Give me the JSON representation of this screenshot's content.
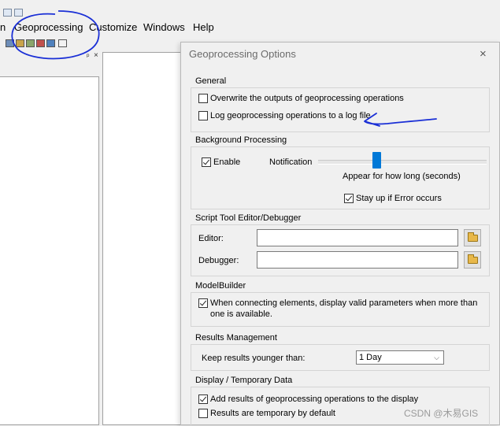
{
  "menubar": {
    "items": [
      "n",
      "Geoprocessing",
      "Customize",
      "Windows",
      "Help"
    ]
  },
  "panel": {
    "pin": "ᵖ",
    "close": "×"
  },
  "dialog": {
    "title": "Geoprocessing Options",
    "close_glyph": "×",
    "general": {
      "title": "General",
      "overwrite": {
        "label": "Overwrite the outputs of geoprocessing operations",
        "checked": false
      },
      "log": {
        "label": "Log geoprocessing operations to a log file",
        "checked": false
      }
    },
    "background": {
      "title": "Background Processing",
      "enable": {
        "label": "Enable",
        "checked": true
      },
      "notification_label": "Notification",
      "slider_caption": "Appear for how long (seconds)",
      "slider_level": 0.35,
      "stay_up": {
        "label": "Stay up if Error occurs",
        "checked": true
      }
    },
    "script_tool": {
      "title": "Script Tool Editor/Debugger",
      "editor_label": "Editor:",
      "editor_value": "",
      "debugger_label": "Debugger:",
      "debugger_value": ""
    },
    "modelbuilder": {
      "title": "ModelBuilder",
      "valid_params": {
        "label": "When connecting elements, display valid parameters when more than one is available.",
        "checked": true
      }
    },
    "results": {
      "title": "Results Management",
      "keep_label": "Keep results younger than:",
      "keep_value": "1 Day"
    },
    "display": {
      "title": "Display / Temporary Data",
      "add_results": {
        "label": "Add results of geoprocessing operations to the display",
        "checked": true
      },
      "temporary": {
        "label": "Results are temporary by default",
        "checked": false
      }
    }
  },
  "watermark": "CSDN @木易GIS",
  "colors": {
    "annotation": "#1a2fd6",
    "slider_thumb": "#0078d7"
  },
  "icons": [
    "folder-icon",
    "close-icon",
    "pin-icon",
    "chevron-down-icon"
  ]
}
